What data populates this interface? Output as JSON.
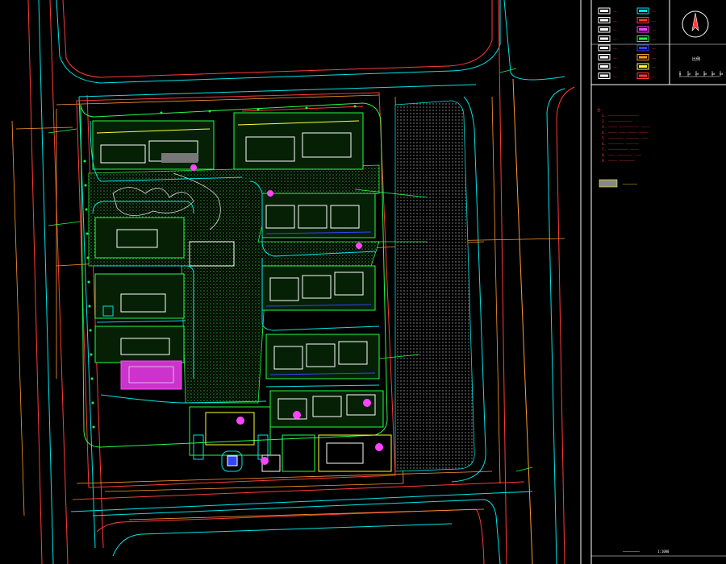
{
  "colors": {
    "background": "#000000",
    "road_red": "#ff3b3b",
    "road_cyan": "#00e5e5",
    "dim_orange": "#ff9a2e",
    "green": "#22ff44",
    "yellow": "#ffff33",
    "white": "#ffffff",
    "magenta": "#ff44ff",
    "blue": "#3344ff"
  },
  "icons": {
    "north_arrow": "north-arrow-icon"
  },
  "legend": {
    "items": [
      {
        "label": "——",
        "swatch": "#ffffff"
      },
      {
        "label": "——",
        "swatch": "#00e5e5"
      },
      {
        "label": "——",
        "swatch": "#ffffff"
      },
      {
        "label": "——",
        "swatch": "#ff3b3b"
      },
      {
        "label": "——",
        "swatch": "#ffffff"
      },
      {
        "label": "——",
        "swatch": "#ff44ff"
      },
      {
        "label": "——",
        "swatch": "#ffffff"
      },
      {
        "label": "——",
        "swatch": "#22ff44"
      },
      {
        "label": "——",
        "swatch": "#ffffff"
      },
      {
        "label": "——",
        "swatch": "#3344ff"
      },
      {
        "label": "——",
        "swatch": "#ffffff"
      },
      {
        "label": "——",
        "swatch": "#ff9a2e"
      },
      {
        "label": "——",
        "swatch": "#ffffff"
      },
      {
        "label": "——",
        "swatch": "#ffff33"
      },
      {
        "label": "——",
        "swatch": "#ffffff"
      },
      {
        "label": "——",
        "swatch": "#ff3b3b"
      }
    ]
  },
  "scale_bar": {
    "label": "比例",
    "ticks": [
      "0",
      "10",
      "20",
      "30",
      "40",
      "50"
    ]
  },
  "notes": {
    "lines": [
      "注:",
      "1. ——————————————",
      "2. ———————————",
      "3. ———— ————————— ————",
      "4. ———— ——— ———— ————",
      "5. ——————— —————— ———",
      "6. ——————— ——————",
      "7. ————————— ————",
      "8. ——— ——————— ———",
      "9. ———— ———————"
    ],
    "legend_label": "——————"
  },
  "drawing_title": "———————",
  "drawing_scale": "1:1000"
}
